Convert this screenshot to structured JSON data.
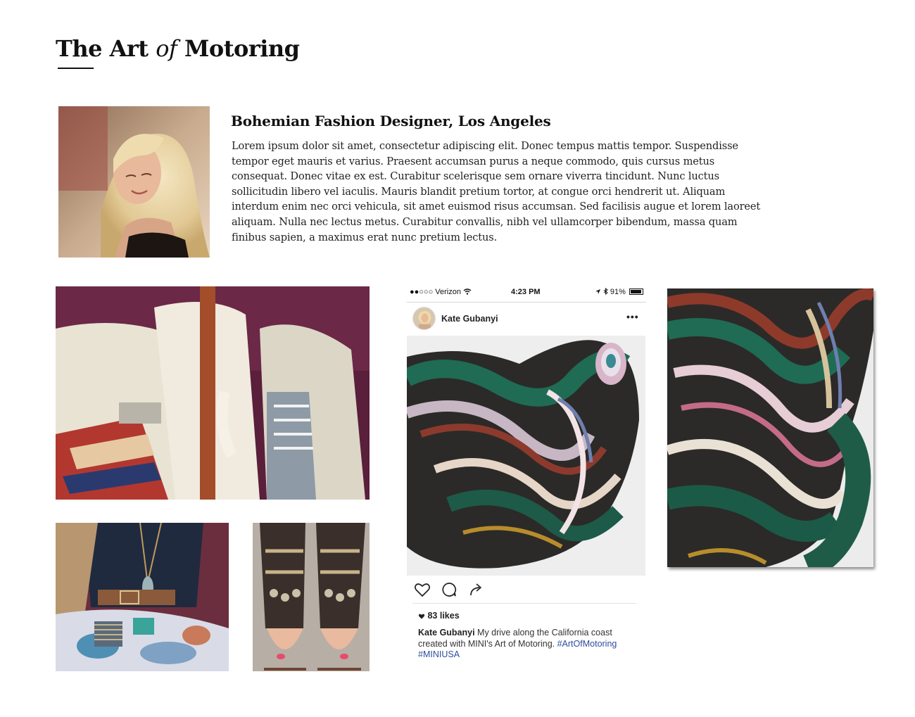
{
  "page": {
    "title_part1": "The Art",
    "title_part2": "of",
    "title_part3": "Motoring"
  },
  "profile": {
    "heading": "Bohemian Fashion Designer, Los Angeles",
    "body": "Lorem ipsum dolor sit amet, consectetur adipiscing elit. Donec tempus mattis tempor. Suspendisse tempor eget mauris et varius. Praesent accumsan purus a neque commodo, quis cursus metus consequat. Donec vitae ex est. Curabitur scelerisque sem ornare viverra tincidunt. Nunc luctus sollicitudin libero vel iaculis. Mauris blandit pretium tortor, at congue orci hendrerit ut. Aliquam interdum enim nec orci vehicula, sit amet euismod risus accumsan. Sed facilisis augue et lorem laoreet aliquam. Nulla nec lectus metus. Curabitur convallis, nibh vel ullamcorper bibendum, massa quam finibus sapien, a maximus erat nunc pretium lectus."
  },
  "phone": {
    "carrier": "●●○○○ Verizon",
    "time": "4:23 PM",
    "battery": "91%"
  },
  "instagram": {
    "username": "Kate Gubanyi",
    "more": "•••",
    "likes": "83 likes",
    "caption_user": "Kate Gubanyi",
    "caption_text": " My drive along the California coast created with MINI's Art of Motoring. ",
    "hashtag1": "#ArtOfMotoring",
    "hashtag2": "#MINIUSA",
    "link_color": "#2d4d9c"
  },
  "icons": {
    "heart": "heart-icon",
    "comment": "comment-icon",
    "share": "share-icon",
    "wifi": "wifi-icon",
    "bluetooth": "bluetooth-icon",
    "location": "location-arrow-icon",
    "battery": "battery-icon"
  }
}
